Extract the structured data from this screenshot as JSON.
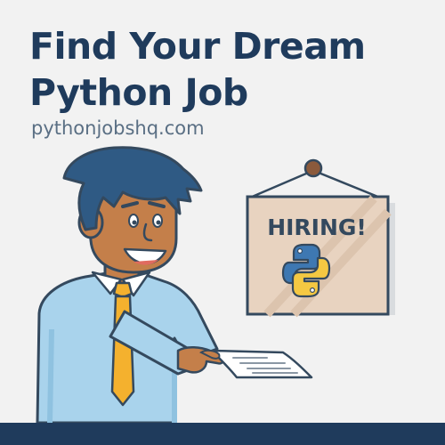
{
  "header": {
    "title_line1": "Find Your Dream",
    "title_line2": "Python Job",
    "url": "pythonjobshq.com"
  },
  "sign": {
    "label": "HIRING!"
  },
  "icons": {
    "logo": "python-logo-icon",
    "person": "man-holding-paper-illustration",
    "paper": "job-listing-paper-icon"
  },
  "colors": {
    "title": "#1f3b5c",
    "url": "#5a6f84",
    "background": "#f2f2f2",
    "sign": "#e8d3c0",
    "shirt": "#a9d3ec",
    "tie": "#f4b12e",
    "footer": "#1f3b5c"
  }
}
